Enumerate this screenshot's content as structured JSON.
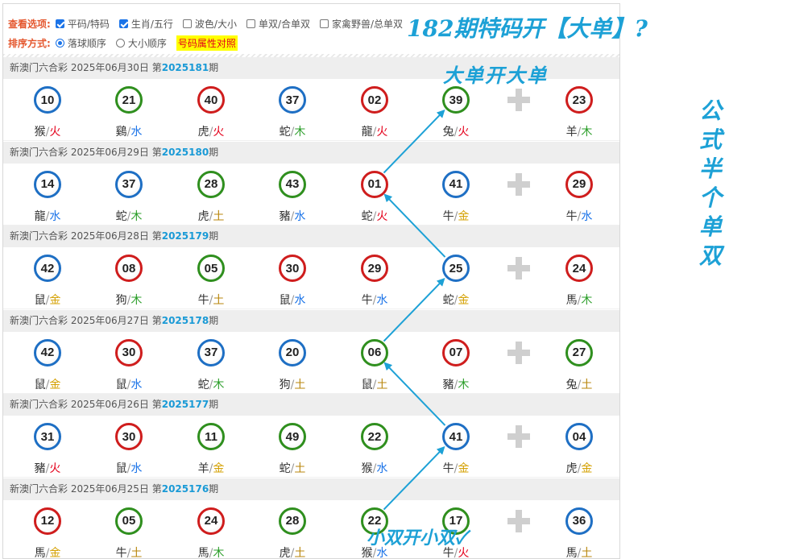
{
  "options": {
    "view_label": "查看选项:",
    "checkboxes": [
      {
        "label": "平码/特码",
        "checked": true
      },
      {
        "label": "生肖/五行",
        "checked": true
      },
      {
        "label": "波色/大小",
        "checked": false
      },
      {
        "label": "单双/合单双",
        "checked": false
      },
      {
        "label": "家禽野兽/总单双",
        "checked": false
      }
    ],
    "sort_label": "排序方式:",
    "radios": [
      {
        "label": "落球顺序",
        "checked": true
      },
      {
        "label": "大小顺序",
        "checked": false
      }
    ],
    "attr_button": "号码属性对照"
  },
  "colors": {
    "red": "#cf1d1d",
    "blue": "#1e6fc4",
    "green": "#2f8f1e",
    "accent": "#1da1d6"
  },
  "draws": [
    {
      "title": "新澳门六合彩 2025年06月30日 第",
      "issue": "2025181",
      "suffix": "期",
      "balls": [
        {
          "num": "10",
          "color": "blue",
          "animal": "猴",
          "element": "火"
        },
        {
          "num": "21",
          "color": "green",
          "animal": "鷄",
          "element": "水"
        },
        {
          "num": "40",
          "color": "red",
          "animal": "虎",
          "element": "火"
        },
        {
          "num": "37",
          "color": "blue",
          "animal": "蛇",
          "element": "木"
        },
        {
          "num": "02",
          "color": "red",
          "animal": "龍",
          "element": "火"
        },
        {
          "num": "39",
          "color": "green",
          "animal": "兔",
          "element": "火"
        },
        {
          "num": "23",
          "color": "red",
          "animal": "羊",
          "element": "木"
        }
      ]
    },
    {
      "title": "新澳门六合彩 2025年06月29日 第",
      "issue": "2025180",
      "suffix": "期",
      "balls": [
        {
          "num": "14",
          "color": "blue",
          "animal": "龍",
          "element": "水"
        },
        {
          "num": "37",
          "color": "blue",
          "animal": "蛇",
          "element": "木"
        },
        {
          "num": "28",
          "color": "green",
          "animal": "虎",
          "element": "土"
        },
        {
          "num": "43",
          "color": "green",
          "animal": "豬",
          "element": "水"
        },
        {
          "num": "01",
          "color": "red",
          "animal": "蛇",
          "element": "火"
        },
        {
          "num": "41",
          "color": "blue",
          "animal": "牛",
          "element": "金"
        },
        {
          "num": "29",
          "color": "red",
          "animal": "牛",
          "element": "水"
        }
      ]
    },
    {
      "title": "新澳门六合彩 2025年06月28日 第",
      "issue": "2025179",
      "suffix": "期",
      "balls": [
        {
          "num": "42",
          "color": "blue",
          "animal": "鼠",
          "element": "金"
        },
        {
          "num": "08",
          "color": "red",
          "animal": "狗",
          "element": "木"
        },
        {
          "num": "05",
          "color": "green",
          "animal": "牛",
          "element": "土"
        },
        {
          "num": "30",
          "color": "red",
          "animal": "鼠",
          "element": "水"
        },
        {
          "num": "29",
          "color": "red",
          "animal": "牛",
          "element": "水"
        },
        {
          "num": "25",
          "color": "blue",
          "animal": "蛇",
          "element": "金"
        },
        {
          "num": "24",
          "color": "red",
          "animal": "馬",
          "element": "木"
        }
      ]
    },
    {
      "title": "新澳门六合彩 2025年06月27日 第",
      "issue": "2025178",
      "suffix": "期",
      "balls": [
        {
          "num": "42",
          "color": "blue",
          "animal": "鼠",
          "element": "金"
        },
        {
          "num": "30",
          "color": "red",
          "animal": "鼠",
          "element": "水"
        },
        {
          "num": "37",
          "color": "blue",
          "animal": "蛇",
          "element": "木"
        },
        {
          "num": "20",
          "color": "blue",
          "animal": "狗",
          "element": "土"
        },
        {
          "num": "06",
          "color": "green",
          "animal": "鼠",
          "element": "土"
        },
        {
          "num": "07",
          "color": "red",
          "animal": "豬",
          "element": "木"
        },
        {
          "num": "27",
          "color": "green",
          "animal": "兔",
          "element": "土"
        }
      ]
    },
    {
      "title": "新澳门六合彩 2025年06月26日 第",
      "issue": "2025177",
      "suffix": "期",
      "balls": [
        {
          "num": "31",
          "color": "blue",
          "animal": "豬",
          "element": "火"
        },
        {
          "num": "30",
          "color": "red",
          "animal": "鼠",
          "element": "水"
        },
        {
          "num": "11",
          "color": "green",
          "animal": "羊",
          "element": "金"
        },
        {
          "num": "49",
          "color": "green",
          "animal": "蛇",
          "element": "土"
        },
        {
          "num": "22",
          "color": "green",
          "animal": "猴",
          "element": "水"
        },
        {
          "num": "41",
          "color": "blue",
          "animal": "牛",
          "element": "金"
        },
        {
          "num": "04",
          "color": "blue",
          "animal": "虎",
          "element": "金"
        }
      ]
    },
    {
      "title": "新澳门六合彩 2025年06月25日 第",
      "issue": "2025176",
      "suffix": "期",
      "balls": [
        {
          "num": "12",
          "color": "red",
          "animal": "馬",
          "element": "金"
        },
        {
          "num": "05",
          "color": "green",
          "animal": "牛",
          "element": "土"
        },
        {
          "num": "24",
          "color": "red",
          "animal": "馬",
          "element": "木"
        },
        {
          "num": "28",
          "color": "green",
          "animal": "虎",
          "element": "土"
        },
        {
          "num": "22",
          "color": "green",
          "animal": "猴",
          "element": "水"
        },
        {
          "num": "17",
          "color": "green",
          "animal": "牛",
          "element": "火"
        },
        {
          "num": "36",
          "color": "blue",
          "animal": "馬",
          "element": "土"
        }
      ]
    }
  ],
  "annotations": {
    "title": "182期特码开【大单】?",
    "big": "大单开大单",
    "small": "小双开小双✓",
    "vertical": "公式半个单双"
  }
}
